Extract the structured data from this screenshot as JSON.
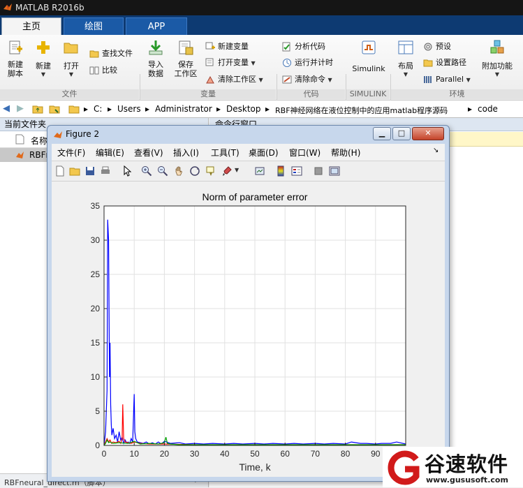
{
  "app": {
    "title": "MATLAB R2016b"
  },
  "tabs": [
    {
      "label": "主页"
    },
    {
      "label": "绘图"
    },
    {
      "label": "APP"
    }
  ],
  "ribbon": {
    "file": {
      "new_script": "新建\n脚本",
      "new": "新建",
      "open": "打开",
      "find_files": "查找文件",
      "compare": "比较",
      "section": "文件"
    },
    "variable": {
      "import_data": "导入\n数据",
      "save_workspace": "保存\n工作区",
      "new_variable": "新建变量",
      "open_variable": "打开变量",
      "clear_workspace": "清除工作区",
      "section": "变量"
    },
    "code": {
      "analyze_code": "分析代码",
      "run_and_time": "运行并计时",
      "clear_commands": "清除命令",
      "section": "代码"
    },
    "simulink": {
      "label": "Simulink",
      "section": "SIMULINK"
    },
    "environment": {
      "layout": "布局",
      "preferences": "预设",
      "set_path": "设置路径",
      "parallel": "Parallel",
      "addons": "附加功能",
      "section": "环境"
    }
  },
  "address": {
    "crumbs": [
      "C:",
      "Users",
      "Administrator",
      "Desktop",
      "RBF神经网络在液位控制中的应用matlab程序源码",
      "code"
    ]
  },
  "left_panel": {
    "header": "当前文件夹",
    "column_name": "名称",
    "selected_item": "RBFn",
    "bottom_file": "RBFneural_direct.m（脚本）"
  },
  "right_panel": {
    "header": "命令行窗口"
  },
  "figure": {
    "title": "Figure 2",
    "menu": [
      "文件(F)",
      "编辑(E)",
      "查看(V)",
      "插入(I)",
      "工具(T)",
      "桌面(D)",
      "窗口(W)",
      "帮助(H)"
    ]
  },
  "chart_data": {
    "type": "line",
    "title": "Norm of parameter error",
    "xlabel": "Time, k",
    "ylabel": "",
    "xlim": [
      0,
      100
    ],
    "ylim": [
      0,
      35
    ],
    "xticks": [
      0,
      10,
      20,
      30,
      40,
      50,
      60,
      70,
      80,
      90,
      100
    ],
    "yticks": [
      0,
      5,
      10,
      15,
      20,
      25,
      30,
      35
    ],
    "grid": true,
    "series": [
      {
        "color": "#0000ff",
        "x": [
          0,
          0.5,
          1,
          1.2,
          1.5,
          1.8,
          2,
          2.2,
          2.4,
          2.6,
          3,
          3.5,
          4,
          4.5,
          5,
          5.5,
          6,
          6.5,
          7,
          7.5,
          8,
          8.5,
          9,
          9.5,
          10,
          10.2,
          10.5,
          11,
          12,
          13,
          14,
          15,
          16,
          17,
          18,
          19,
          20,
          22,
          25,
          27,
          30,
          33,
          36,
          40,
          43,
          46,
          50,
          53,
          56,
          60,
          63,
          66,
          70,
          73,
          76,
          80,
          82,
          85,
          87,
          90,
          92,
          95,
          97,
          100
        ],
        "y": [
          0,
          2,
          8,
          33,
          30,
          10,
          15,
          6,
          3,
          1.5,
          2.5,
          1,
          1.5,
          0.5,
          2,
          0.8,
          1.2,
          0.3,
          0.8,
          0.4,
          0.5,
          0.3,
          1,
          0.5,
          7.5,
          2,
          1,
          0.5,
          0.4,
          0.3,
          0.5,
          0.2,
          0.4,
          0.2,
          0.5,
          0.2,
          0.6,
          0.3,
          0.4,
          0.2,
          0.3,
          0.2,
          0.3,
          0.2,
          0.3,
          0.2,
          0.3,
          0.2,
          0.3,
          0.2,
          0.3,
          0.2,
          0.3,
          0.2,
          0.3,
          0.2,
          0.5,
          0.3,
          0.3,
          0.2,
          0.3,
          0.3,
          0.5,
          0.2
        ]
      },
      {
        "color": "#ff0000",
        "x": [
          0,
          0.5,
          1,
          1.5,
          2,
          2.5,
          3,
          4,
          5,
          5.5,
          6,
          6.2,
          6.5,
          7,
          8,
          9,
          10,
          12,
          15,
          20,
          30,
          40,
          50,
          60,
          70,
          80,
          90,
          100
        ],
        "y": [
          0,
          0.5,
          1,
          0.5,
          0.8,
          0.3,
          0.5,
          0.4,
          0.6,
          0.3,
          1,
          6,
          1,
          0.5,
          0.4,
          0.3,
          0.5,
          0.3,
          0.2,
          0.2,
          0.1,
          0.1,
          0.1,
          0.1,
          0.1,
          0.1,
          0.1,
          0.1
        ]
      },
      {
        "color": "#00a000",
        "x": [
          0,
          0.5,
          1,
          1.5,
          2,
          3,
          5,
          8,
          10,
          12,
          15,
          18,
          20,
          20.5,
          21,
          22,
          25,
          30,
          40,
          50,
          60,
          70,
          80,
          90,
          100
        ],
        "y": [
          0,
          0.3,
          0.8,
          0.4,
          0.5,
          0.3,
          0.4,
          0.3,
          0.6,
          0.2,
          0.3,
          0.2,
          0.4,
          1.2,
          0.3,
          0.2,
          0.1,
          0.1,
          0.1,
          0.1,
          0.1,
          0.1,
          0.1,
          0.1,
          0.1
        ]
      }
    ]
  },
  "colors": {
    "tab_bar": "#0d3a72",
    "tab_active": "#f4f4f4",
    "title_bar": "#151515",
    "watermark_red": "#d11a1a"
  },
  "watermark": {
    "brand": "谷速软件",
    "url": "www.gususoft.com"
  }
}
